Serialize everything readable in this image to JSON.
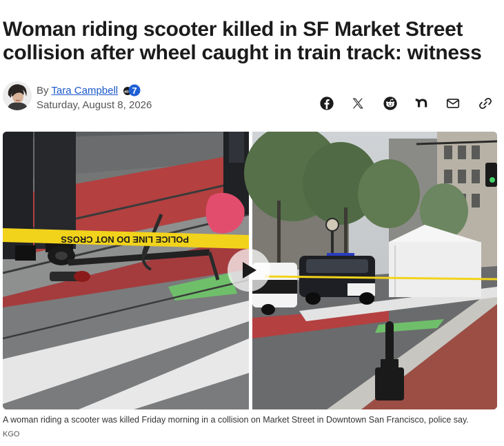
{
  "article": {
    "headline": "Woman riding scooter killed in SF Market Street collision after wheel caught in train track: witness"
  },
  "byline": {
    "by_label": "By",
    "author": "Tara Campbell",
    "station_logo_icon": "abc7-logo-icon",
    "date": "Saturday, August 8, 2026"
  },
  "share": {
    "items": [
      {
        "name": "facebook-icon"
      },
      {
        "name": "x-icon"
      },
      {
        "name": "reddit-icon"
      },
      {
        "name": "nextdoor-icon"
      },
      {
        "name": "email-icon"
      },
      {
        "name": "copy-link-icon"
      }
    ]
  },
  "media": {
    "scene_left": {
      "tape_text": "POLICE LINE DO NOT CROSS",
      "tape_text_mirrored": "POLICE LINE DO NOT CROSS"
    },
    "play_icon": "play-icon",
    "caption": "A woman riding a scooter was killed Friday morning in a collision on Market Street in Downtown San Francisco, police say.",
    "credit": "KGO"
  },
  "colors": {
    "headline": "#1b1b1b",
    "link": "#1a57c9",
    "meta": "#555555",
    "tape": "#f2d31b",
    "bike_lane_red": "#b44040",
    "bike_lane_green": "#6fbf6a"
  }
}
